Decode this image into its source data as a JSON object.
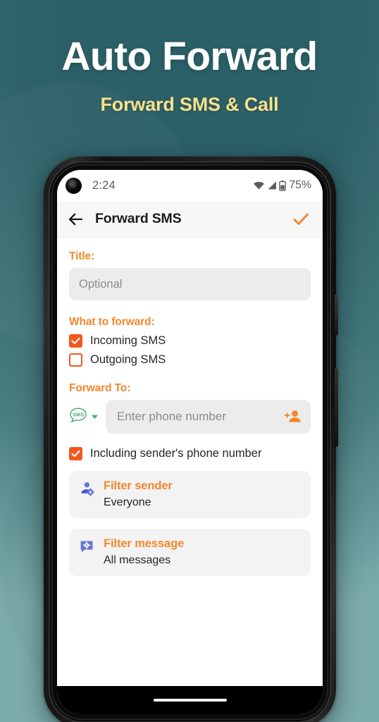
{
  "promo": {
    "title": "Auto Forward",
    "subtitle": "Forward SMS & Call",
    "title_color": "#ffffff",
    "subtitle_color": "#fbe08a",
    "background_top_color": "#2a5f67",
    "background_bottom_color": "#7cabab"
  },
  "phone": {
    "status_bar": {
      "time": "2:24",
      "battery_text": "75%",
      "icons": [
        "wifi-icon",
        "signal-icon",
        "battery-icon"
      ]
    },
    "app_bar": {
      "back_icon": "back-arrow-icon",
      "title": "Forward SMS",
      "confirm_icon": "check-icon",
      "accent_color": "#f5862a"
    },
    "content": {
      "title_section": {
        "label": "Title:",
        "input_placeholder": "Optional",
        "input_value": ""
      },
      "what_to_forward": {
        "label": "What to forward:",
        "options": [
          {
            "label": "Incoming SMS",
            "checked": true
          },
          {
            "label": "Outgoing SMS",
            "checked": false
          }
        ]
      },
      "forward_to": {
        "label": "Forward To:",
        "channel_icon": "sms-bubble-icon",
        "channel_label": "SMS",
        "channel_caret": "chevron-down-icon",
        "input_placeholder": "Enter phone number",
        "input_value": "",
        "add_contact_icon": "add-contact-icon"
      },
      "include_sender": {
        "label": "Including sender's phone number",
        "checked": true
      },
      "filters": [
        {
          "icon": "person-settings-icon",
          "title": "Filter sender",
          "value": "Everyone"
        },
        {
          "icon": "message-settings-icon",
          "title": "Filter message",
          "value": "All messages"
        }
      ]
    },
    "gesture_bar": "home-indicator"
  },
  "colors": {
    "accent_orange": "#f5862a",
    "checkbox_orange": "#f4581e",
    "sms_green": "#4caf72",
    "filter_icon_blue": "#6a74d6"
  }
}
